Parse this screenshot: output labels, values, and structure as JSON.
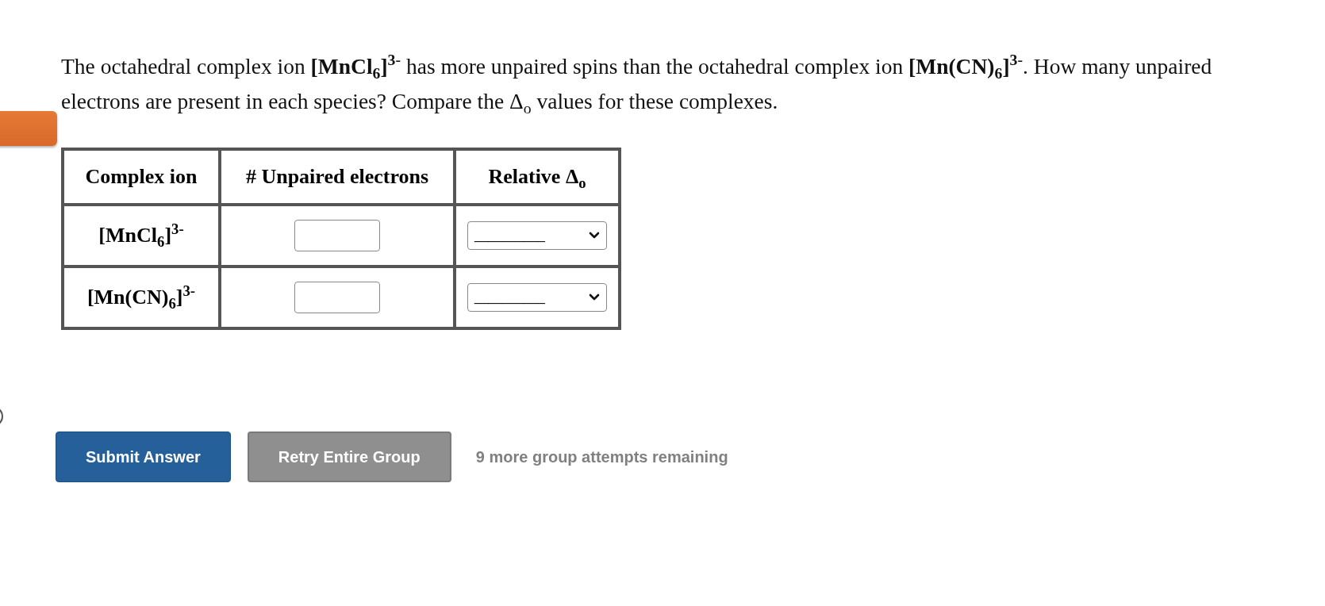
{
  "question": "The octahedral complex ion **[MnCl**$_{6}$**]**$^{3-}$ has more unpaired spins than the octahedral complex ion **[Mn(CN)**$_{6}$**]**$^{3-}$. How many unpaired electrons are present in each species? Compare the Δ$_{o}$ values for these complexes.",
  "table": {
    "columns": [
      "Complex ion",
      "# Unpaired electrons",
      "Relative Δ$_{o}$"
    ],
    "rows": [
      {
        "ion": "[MnCl$_{6}$]$^{3-}$",
        "dropdown": "__________"
      },
      {
        "ion": "[Mn(CN)$_{6}$]$^{3-}$",
        "dropdown": "__________"
      }
    ]
  },
  "buttons": [
    {
      "label": "Submit Answer",
      "kind": "primary"
    },
    {
      "label": "Retry Entire Group",
      "kind": "secondary"
    }
  ],
  "attempts": "9 more group attempts remaining"
}
